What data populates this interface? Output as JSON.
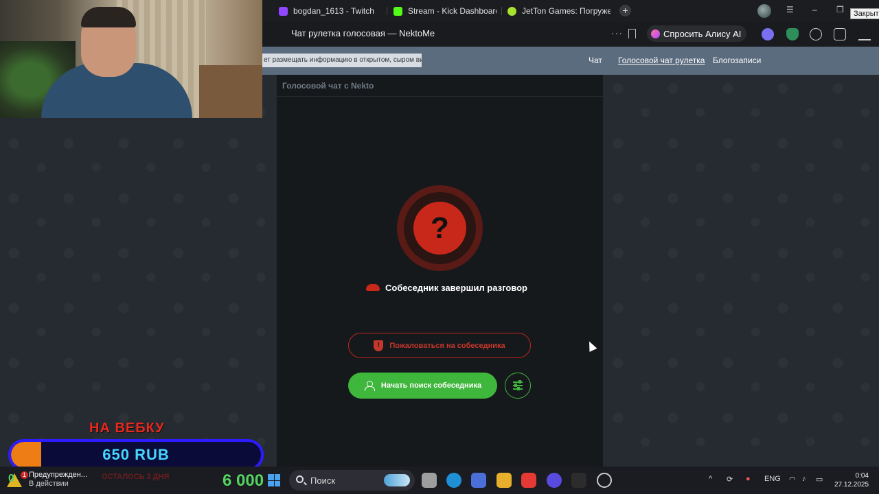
{
  "browser": {
    "tabs": [
      {
        "label": "bogdan_1613 - Twitch",
        "icon": "twitch-icon",
        "color": "#9146ff"
      },
      {
        "label": "Stream - Kick Dashboard",
        "icon": "kick-icon",
        "color": "#53fc18"
      },
      {
        "label": "JetTon Games: Погружен",
        "icon": "jetton-icon",
        "color": "#a6e22e"
      }
    ],
    "page_title": "Чат рулетка голосовая — NektoMe",
    "alice_label": "Спросить Алису AI",
    "close_tooltip": "Закрыть"
  },
  "site_nav": {
    "warning": "ет размещать информацию в открытом, сыром виде!",
    "links": [
      {
        "label": "Чат",
        "active": false
      },
      {
        "label": "Голосовой чат рулетка",
        "active": true
      },
      {
        "label": "Блогозаписи",
        "active": false
      }
    ]
  },
  "chat": {
    "header": "Голосовой чат с Nekto",
    "status_symbol": "?",
    "status_text": "Собеседник завершил разговор",
    "report_label": "Пожаловаться на собеседника",
    "start_label": "Начать поиск собеседника",
    "colors": {
      "accent_red": "#c8281a",
      "accent_green": "#3fb63c"
    }
  },
  "donation": {
    "title": "НА ВЕБКУ",
    "amount": "650 RUB",
    "progress": 0.12,
    "remaining": "ОСТАЛОСЬ 3 ДНЯ"
  },
  "taskbar": {
    "warning_title": "Предупрежден...",
    "warning_sub": "В действии",
    "warning_badge": "1",
    "counter_left": "0",
    "big_number": "6 000",
    "search_placeholder": "Поиск",
    "lang": "ENG",
    "time": "0:04",
    "date": "27.12.2025"
  }
}
